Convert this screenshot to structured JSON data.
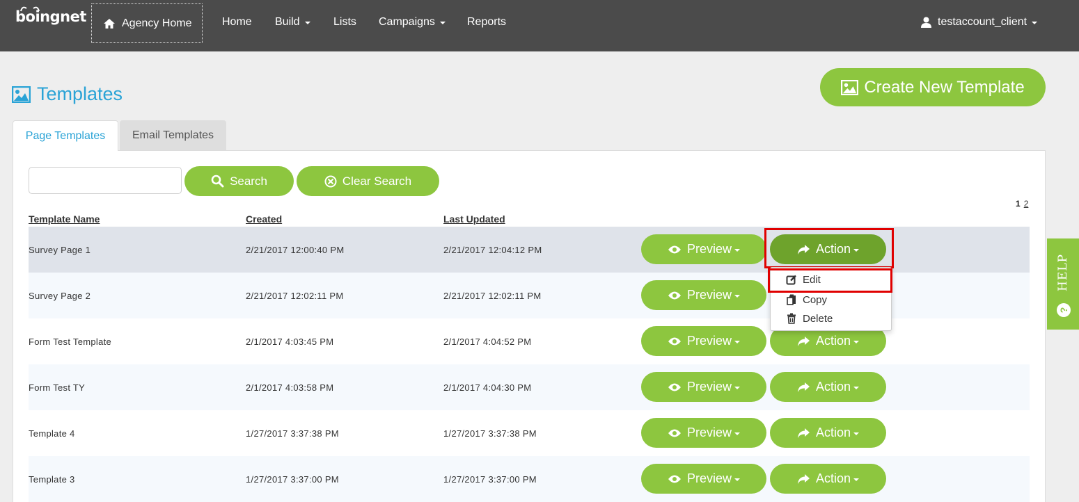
{
  "nav": {
    "logo": "boingnet",
    "agency_home": "Agency Home",
    "items": [
      {
        "label": "Home",
        "has_caret": false
      },
      {
        "label": "Build",
        "has_caret": true
      },
      {
        "label": "Lists",
        "has_caret": false
      },
      {
        "label": "Campaigns",
        "has_caret": true
      },
      {
        "label": "Reports",
        "has_caret": false
      }
    ],
    "user": "testaccount_client"
  },
  "page": {
    "title": "Templates",
    "create_button": "Create New Template"
  },
  "tabs": [
    {
      "label": "Page Templates",
      "active": true
    },
    {
      "label": "Email Templates",
      "active": false
    }
  ],
  "search": {
    "placeholder": "",
    "value": "",
    "search_button": "Search",
    "clear_button": "Clear Search"
  },
  "pagination": {
    "current": "1",
    "next": "2"
  },
  "table": {
    "headers": [
      "Template Name",
      "Created",
      "Last Updated"
    ],
    "preview_label": "Preview",
    "action_label": "Action",
    "rows": [
      {
        "name": "Survey Page 1",
        "created": "2/21/2017 12:00:40 PM",
        "updated": "2/21/2017 12:04:12 PM"
      },
      {
        "name": "Survey Page 2",
        "created": "2/21/2017 12:02:11 PM",
        "updated": "2/21/2017 12:02:11 PM"
      },
      {
        "name": "Form Test Template",
        "created": "2/1/2017 4:03:45 PM",
        "updated": "2/1/2017 4:04:52 PM"
      },
      {
        "name": "Form Test TY",
        "created": "2/1/2017 4:03:58 PM",
        "updated": "2/1/2017 4:04:30 PM"
      },
      {
        "name": "Template 4",
        "created": "1/27/2017 3:37:38 PM",
        "updated": "1/27/2017 3:37:38 PM"
      },
      {
        "name": "Template 3",
        "created": "1/27/2017 3:37:00 PM",
        "updated": "1/27/2017 3:37:00 PM"
      }
    ]
  },
  "action_menu": {
    "items": [
      "Edit",
      "Copy",
      "Delete"
    ]
  },
  "help": {
    "label": "HELP",
    "icon": "?"
  },
  "colors": {
    "brand_green": "#8dc63f",
    "active_green": "#6ea32c",
    "title_blue": "#2aa3d6",
    "navbar": "#4b4b4b",
    "highlight_red": "#e00000"
  }
}
